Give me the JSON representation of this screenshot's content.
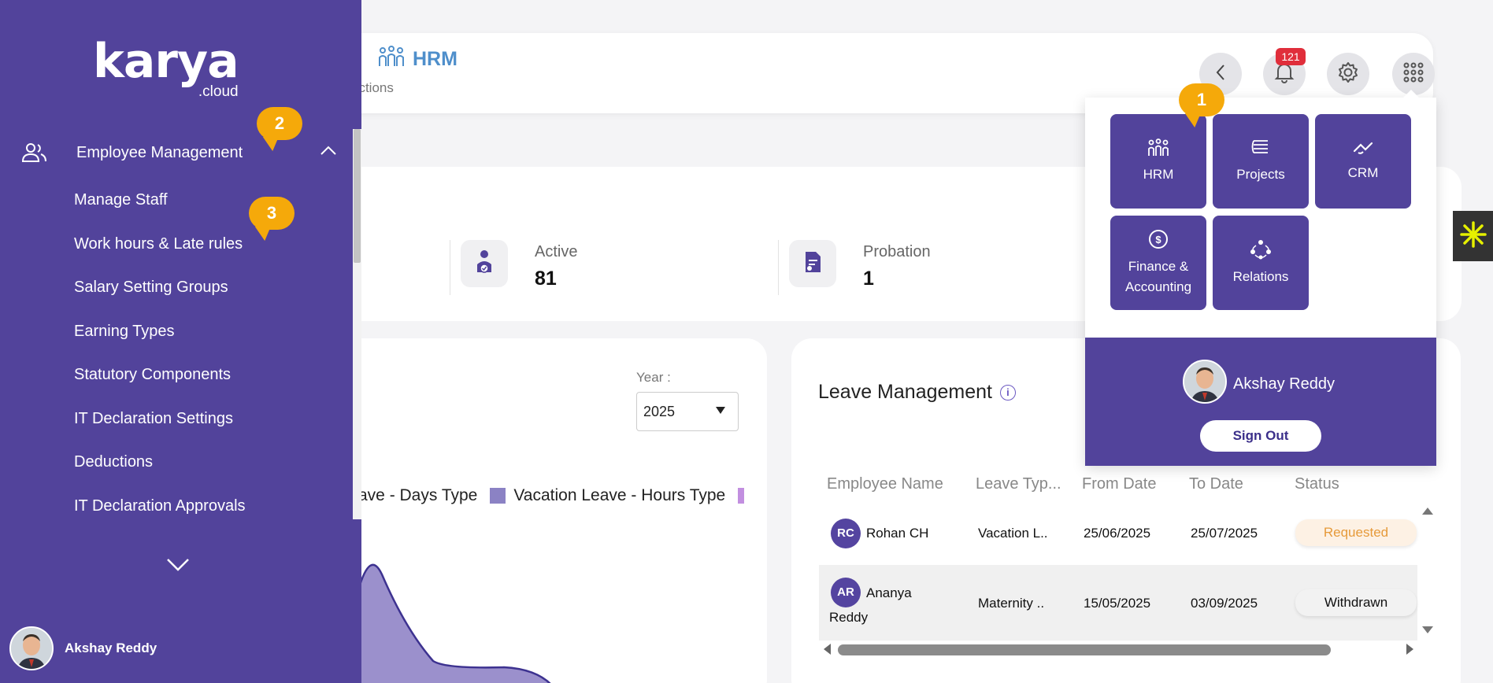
{
  "sidebar": {
    "logo": {
      "main": "karya",
      "sub": ".cloud"
    },
    "section_label": "Employee Management",
    "items": [
      {
        "label": "Manage Staff"
      },
      {
        "label": "Work hours & Late rules"
      },
      {
        "label": "Salary Setting Groups"
      },
      {
        "label": "Earning Types"
      },
      {
        "label": "Statutory Components"
      },
      {
        "label": "IT Declaration Settings"
      },
      {
        "label": "Deductions"
      },
      {
        "label": "IT Declaration Approvals"
      }
    ],
    "user_name": "Akshay Reddy"
  },
  "header": {
    "module_title": "HRM",
    "sub_crumb": "actions",
    "notification_count": "121",
    "icons": [
      "chevron-left-icon",
      "bell-icon",
      "gear-icon",
      "grid-icon"
    ]
  },
  "callouts": [
    "1",
    "2",
    "3"
  ],
  "stats": [
    {
      "label": "Active",
      "value": "81",
      "icon": "person-check-icon"
    },
    {
      "label": "Probation",
      "value": "1",
      "icon": "document-icon"
    }
  ],
  "chart_card": {
    "year_label": "Year :",
    "year_value": "2025",
    "legend": [
      "ave - Days Type",
      "Vacation Leave - Hours Type"
    ],
    "colors": {
      "days": "#8b82c4",
      "hours": "#9b88cf",
      "next": "#c28fe0"
    }
  },
  "leave": {
    "title": "Leave Management",
    "info_icon": "i",
    "columns": [
      "Employee Name",
      "Leave Typ...",
      "From Date",
      "To Date",
      "Status"
    ],
    "rows": [
      {
        "initials": "RC",
        "name": "Rohan CH",
        "name2": "",
        "type": "Vacation L..",
        "from": "25/06/2025",
        "to": "25/07/2025",
        "status": "Requested",
        "status_color": "#e69a3a",
        "status_bg": "#fdf1e4"
      },
      {
        "initials": "AR",
        "name": "Ananya",
        "name2": "Reddy",
        "type": "Maternity ..",
        "from": "15/05/2025",
        "to": "03/09/2025",
        "status": "Withdrawn",
        "status_color": "#111111",
        "status_bg": "#f2f2f2"
      }
    ]
  },
  "apps_menu": {
    "tiles": [
      {
        "label": "HRM",
        "icon": "people-icon"
      },
      {
        "label": "Projects",
        "icon": "layers-icon"
      },
      {
        "label": "CRM",
        "icon": "handshake-icon"
      },
      {
        "label": "Finance & Accounting",
        "icon": "dollar-icon"
      },
      {
        "label": "Relations",
        "icon": "network-icon"
      }
    ],
    "user_name": "Akshay Reddy",
    "sign_out": "Sign Out"
  },
  "theme": {
    "primary": "#52439b",
    "accent": "#f5a90a",
    "badge": "#e02e3b"
  }
}
